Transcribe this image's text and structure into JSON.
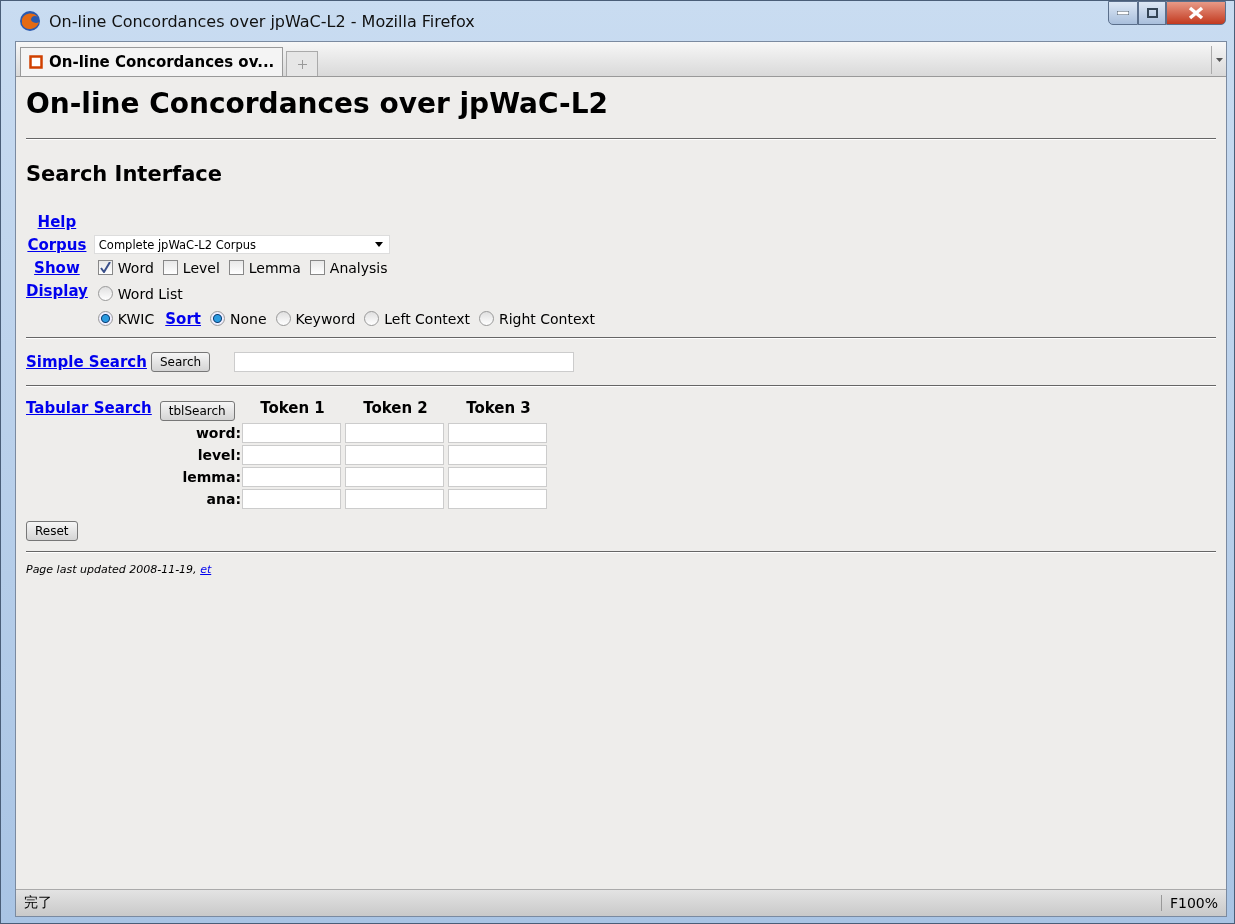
{
  "window": {
    "title": "On-line Concordances over jpWaC-L2 - Mozilla Firefox"
  },
  "tabs": [
    {
      "label": "On-line Concordances ov...",
      "selected": true
    }
  ],
  "page": {
    "heading": "On-line Concordances over jpWaC-L2",
    "subheading": "Search Interface",
    "help": {
      "label": "Help"
    },
    "corpus": {
      "label": "Corpus",
      "value": "Complete jpWaC-L2 Corpus"
    },
    "show": {
      "label": "Show",
      "options": [
        {
          "label": "Word",
          "checked": true
        },
        {
          "label": "Level",
          "checked": false
        },
        {
          "label": "Lemma",
          "checked": false
        },
        {
          "label": "Analysis",
          "checked": false
        }
      ]
    },
    "display": {
      "label": "Display",
      "modes": [
        {
          "label": "Word List",
          "selected": false
        },
        {
          "label": "KWIC",
          "selected": true
        }
      ],
      "sort": {
        "label": "Sort",
        "options": [
          {
            "label": "None",
            "selected": true
          },
          {
            "label": "Keyword",
            "selected": false
          },
          {
            "label": "Left Context",
            "selected": false
          },
          {
            "label": "Right Context",
            "selected": false
          }
        ]
      }
    },
    "simple_search": {
      "label": "Simple Search",
      "button": "Search"
    },
    "tabular_search": {
      "label": "Tabular Search",
      "button": "tblSearch",
      "columns": [
        "Token 1",
        "Token 2",
        "Token 3"
      ],
      "rows": [
        {
          "label": "word:"
        },
        {
          "label": "level:"
        },
        {
          "label": "lemma:"
        },
        {
          "label": "ana:"
        }
      ]
    },
    "reset": "Reset",
    "footer": {
      "text": "Page last updated 2008-11-19,",
      "link": "et"
    }
  },
  "status_bar": {
    "text": "完了",
    "zoom": "F100%"
  }
}
